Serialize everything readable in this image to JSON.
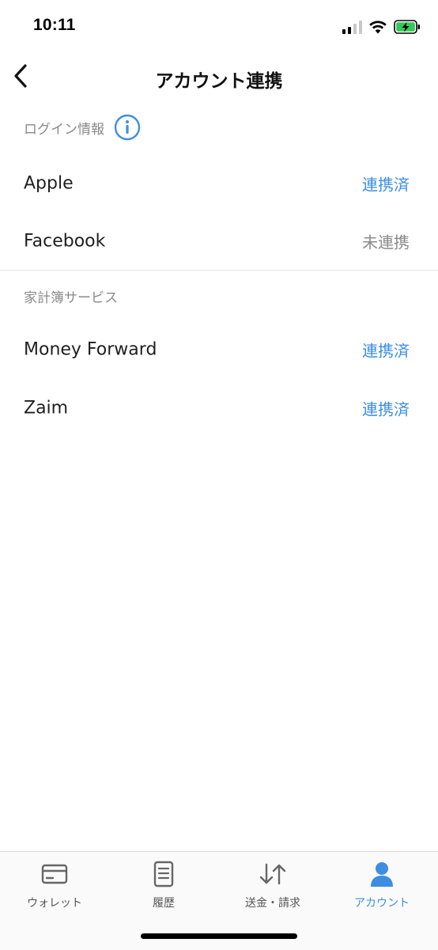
{
  "status_bar": {
    "time": "10:11"
  },
  "header": {
    "back_icon": "chevron-left",
    "title": "アカウント連携"
  },
  "sections": {
    "login": {
      "title": "ログイン情報",
      "info_icon": "info-circle",
      "rows": [
        {
          "label": "Apple",
          "status": "連携済",
          "linked": true
        },
        {
          "label": "Facebook",
          "status": "未連携",
          "linked": false
        }
      ]
    },
    "household": {
      "title": "家計簿サービス",
      "rows": [
        {
          "label": "Money Forward",
          "status": "連携済",
          "linked": true
        },
        {
          "label": "Zaim",
          "status": "連携済",
          "linked": true
        }
      ]
    }
  },
  "tab_bar": {
    "tabs": [
      {
        "label": "ウォレット",
        "icon": "wallet-card",
        "active": false
      },
      {
        "label": "履歴",
        "icon": "document-list",
        "active": false
      },
      {
        "label": "送金・請求",
        "icon": "transfer-arrows",
        "active": false
      },
      {
        "label": "アカウント",
        "icon": "person",
        "active": true
      }
    ]
  },
  "colors": {
    "accent": "#3d8ee3",
    "muted": "#8a8a8a",
    "battery": "#34c759"
  }
}
